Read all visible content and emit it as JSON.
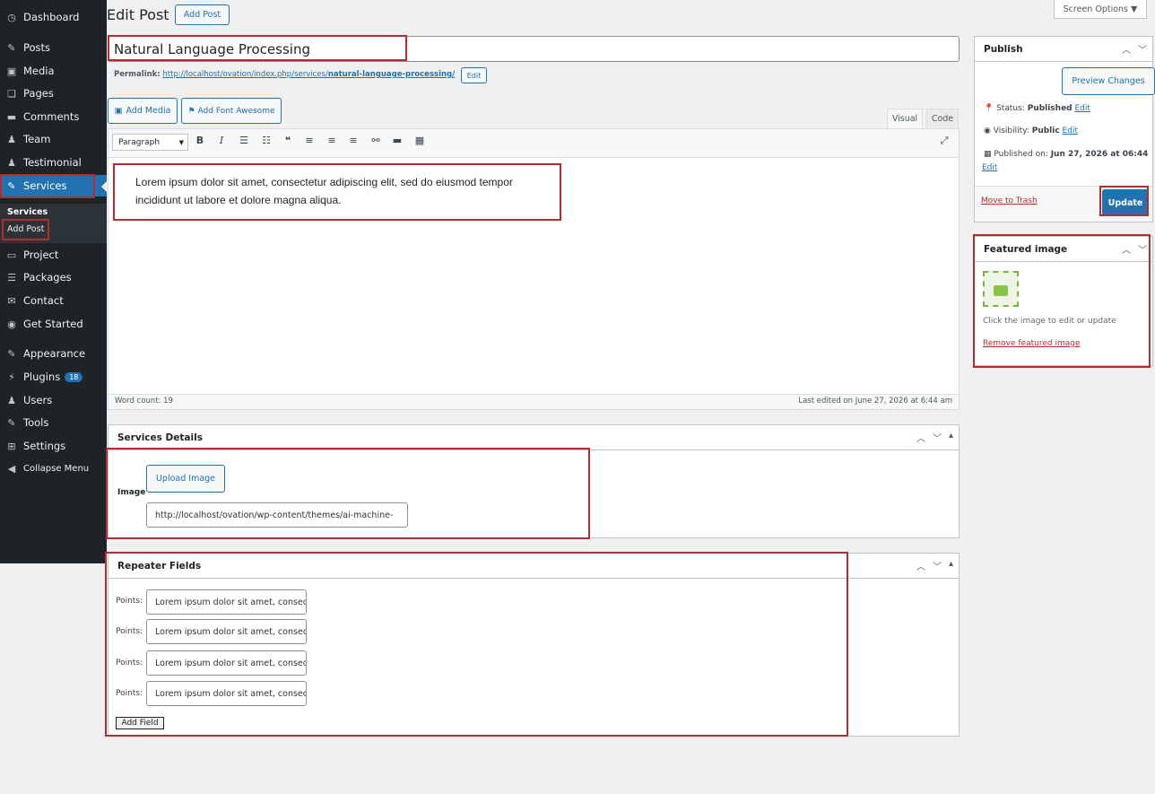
{
  "sidebar": {
    "items": [
      {
        "label": "Dashboard",
        "icon": "dashboard-icon",
        "glyph": "◷"
      },
      {
        "label": "Posts",
        "icon": "pin-icon",
        "glyph": "✎"
      },
      {
        "label": "Media",
        "icon": "media-icon",
        "glyph": "▣"
      },
      {
        "label": "Pages",
        "icon": "pages-icon",
        "glyph": "❏"
      },
      {
        "label": "Comments",
        "icon": "comments-icon",
        "glyph": "▬"
      },
      {
        "label": "Team",
        "icon": "team-icon",
        "glyph": "♟"
      },
      {
        "label": "Testimonial",
        "icon": "testimonial-icon",
        "glyph": "♟"
      },
      {
        "label": "Services",
        "icon": "wrench-icon",
        "glyph": "✎"
      },
      {
        "label": "Project",
        "icon": "folder-icon",
        "glyph": "▭"
      },
      {
        "label": "Packages",
        "icon": "packages-icon",
        "glyph": "☰"
      },
      {
        "label": "Contact",
        "icon": "mail-icon",
        "glyph": "✉"
      },
      {
        "label": "Get Started",
        "icon": "globe-icon",
        "glyph": "◉"
      },
      {
        "label": "Appearance",
        "icon": "brush-icon",
        "glyph": "✎"
      },
      {
        "label": "Plugins",
        "icon": "plugin-icon",
        "glyph": "⚡",
        "badge": "18"
      },
      {
        "label": "Users",
        "icon": "users-icon",
        "glyph": "♟"
      },
      {
        "label": "Tools",
        "icon": "tools-icon",
        "glyph": "✎"
      },
      {
        "label": "Settings",
        "icon": "settings-icon",
        "glyph": "⊞"
      },
      {
        "label": "Collapse Menu",
        "icon": "collapse-icon",
        "glyph": "◀"
      }
    ],
    "submenu_title": "Services",
    "submenu_item": "Add Post"
  },
  "header": {
    "title": "Edit Post",
    "add_post": "Add Post",
    "screen_options": "Screen Options ▼"
  },
  "post": {
    "title": "Natural Language Processing",
    "permalink_label": "Permalink:",
    "permalink_base": "http://localhost/ovation/index.php/services/",
    "permalink_slug": "natural-language-processing/",
    "permalink_edit": "Edit"
  },
  "editor": {
    "add_media": "Add Media",
    "add_font_awesome": "Add Font Awesome",
    "tab_visual": "Visual",
    "tab_code": "Code",
    "format": "Paragraph",
    "content_line1": "Lorem ipsum dolor sit amet, consectetur adipiscing elit, sed do eiusmod tempor",
    "content_line2": "incididunt ut labore et dolore magna aliqua.",
    "word_count": "Word count: 19",
    "last_edited": "Last edited on June 27, 2026 at 6:44 am"
  },
  "publish": {
    "title": "Publish",
    "preview": "Preview Changes",
    "status_label": "Status:",
    "status_value": "Published",
    "visibility_label": "Visibility:",
    "visibility_value": "Public",
    "published_label": "Published on:",
    "published_value": "Jun 27, 2026 at 06:44",
    "edit": "Edit",
    "trash": "Move to Trash",
    "update": "Update"
  },
  "featured": {
    "title": "Featured image",
    "hint": "Click the image to edit or update",
    "remove": "Remove featured image"
  },
  "services_details": {
    "title": "Services Details",
    "image_label": "Image",
    "upload": "Upload Image",
    "url": "http://localhost/ovation/wp-content/themes/ai-machine-"
  },
  "repeater": {
    "title": "Repeater Fields",
    "point_label": "Points:",
    "points": [
      "Lorem ipsum dolor sit amet, consectetur",
      "Lorem ipsum dolor sit amet, consectetur",
      "Lorem ipsum dolor sit amet, consectetur",
      "Lorem ipsum dolor sit amet, consectetur"
    ],
    "add_field": "Add Field"
  }
}
